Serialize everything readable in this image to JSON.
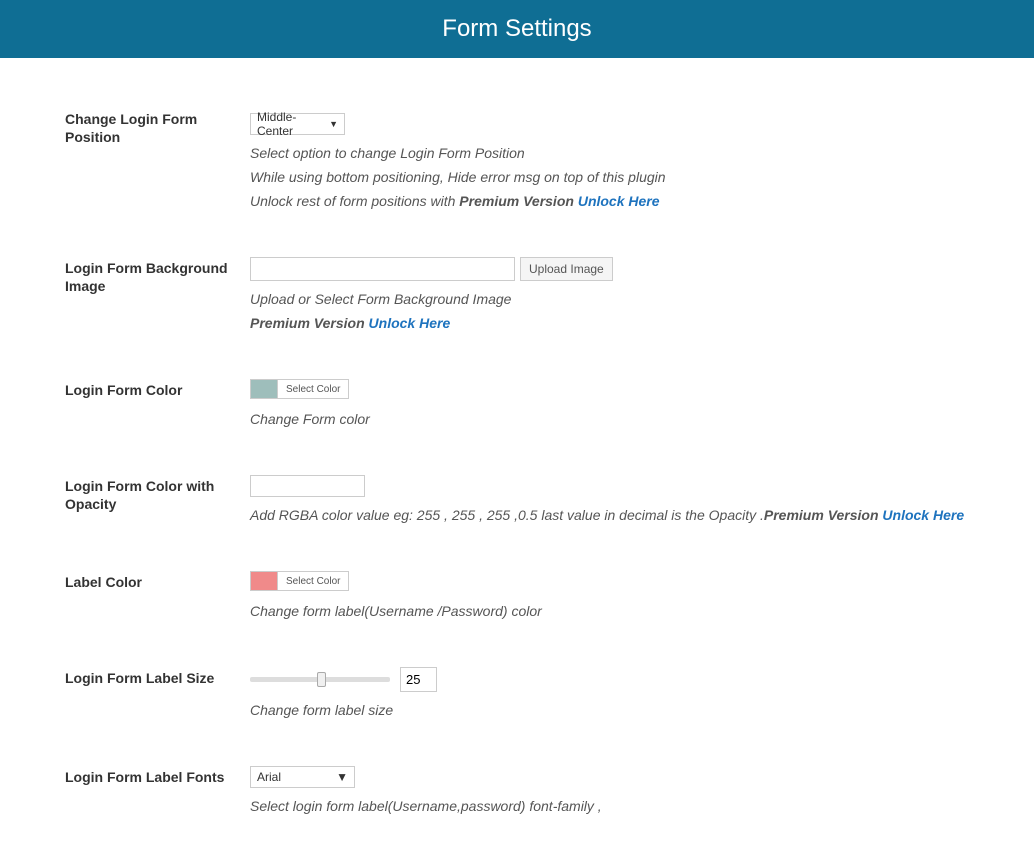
{
  "header": {
    "title": "Form Settings"
  },
  "rows": {
    "position": {
      "label": "Change Login Form Position",
      "selectValue": "Middle-Center",
      "help1": "Select option to change Login Form Position",
      "help2": "While using bottom positioning, Hide error msg on top of this plugin",
      "help3_prefix": "Unlock rest of form positions with ",
      "premium": "Premium Version",
      "unlock": "Unlock Here"
    },
    "bgImage": {
      "label": "Login Form Background Image",
      "uploadBtn": "Upload Image",
      "help1": "Upload or Select Form Background Image",
      "premium": "Premium Version",
      "unlock": "Unlock Here"
    },
    "formColor": {
      "label": "Login Form Color",
      "btn": "Select Color",
      "help": "Change Form color"
    },
    "formColorOpacity": {
      "label": "Login Form Color with Opacity",
      "help_prefix": "Add RGBA color value eg: 255 , 255 , 255 ,0.5 last value in decimal is the Opacity .",
      "premium": "Premium Version",
      "unlock": "Unlock Here"
    },
    "labelColor": {
      "label": "Label Color",
      "btn": "Select Color",
      "help": "Change form label(Username /Password) color"
    },
    "labelSize": {
      "label": "Login Form Label Size",
      "value": "25",
      "help": "Change form label size"
    },
    "labelFonts": {
      "label": "Login Form Label Fonts",
      "selectValue": "Arial",
      "help": "Select login form label(Username,password) font-family ,"
    }
  }
}
